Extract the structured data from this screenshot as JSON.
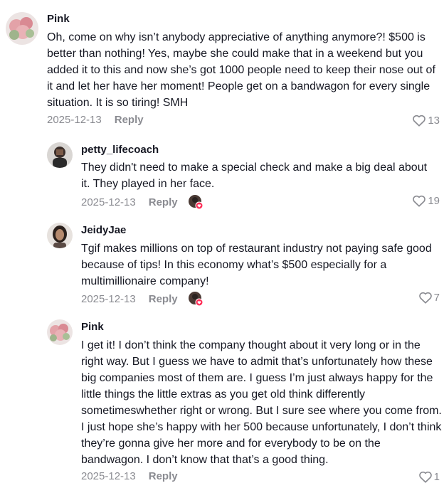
{
  "comments": [
    {
      "username": "Pink",
      "text": "Oh, come on why isn’t anybody appreciative of anything anymore?! $500 is better than nothing! Yes, maybe she could make that in a weekend but you added it to this and now she’s got 1000 people need to keep their nose out of it and let her have her moment! People get on a bandwagon for every single situation. It is so tiring! SMH",
      "date": "2025-12-13",
      "reply_label": "Reply",
      "likes": "13"
    },
    {
      "username": "petty_lifecoach",
      "text": "They didn't need to make a special check and make a big deal about it. They played in her face.",
      "date": "2025-12-13",
      "reply_label": "Reply",
      "likes": "19"
    },
    {
      "username": "JeidyJae",
      "text": "Tgif makes millions on top of restaurant industry not paying safe good because of tips! In this economy what’s $500 especially for a multimillionaire company!",
      "date": "2025-12-13",
      "reply_label": "Reply",
      "likes": "7"
    },
    {
      "username": "Pink",
      "text": "I get it! I don’t think the company thought about it very long or in the right way. But I guess we have to admit that’s unfortunately how these big companies most of them are. I guess I’m just always happy for the little things the little extras as you get old think differently sometimeswhether right or wrong. But I sure see where you come from. I just hope she’s happy with her 500 because unfortunately, I don’t think they’re gonna give her more and for everybody to be on the bandwagon. I don’t know that that’s a good thing.",
      "date": "2025-12-13",
      "reply_label": "Reply",
      "likes": "1"
    }
  ],
  "colors": {
    "text": "#161823",
    "muted": "#8a8b91",
    "heart_outline": "#8a8b91",
    "creator_badge": "#fe2c55"
  },
  "icons": {
    "like": "heart-outline-icon",
    "creator_liked": "creator-liked-badge-icon"
  }
}
